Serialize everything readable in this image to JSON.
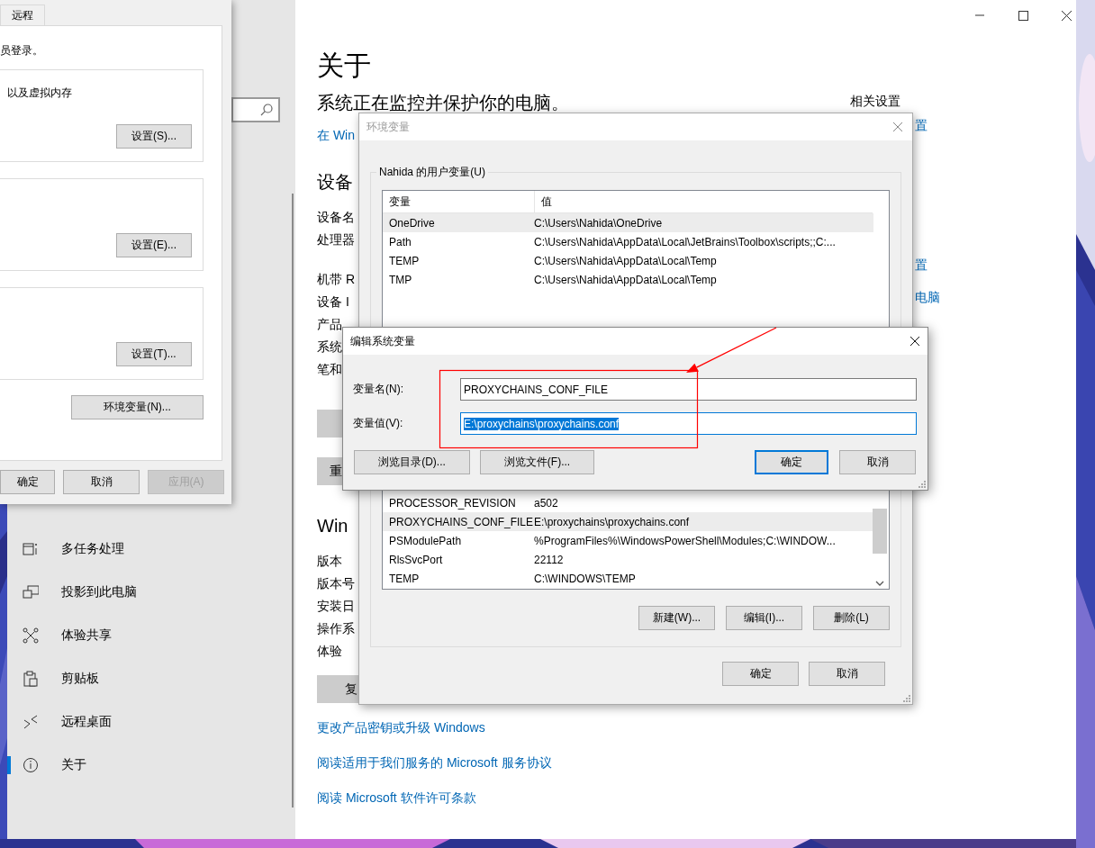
{
  "settings": {
    "nav": [
      {
        "label": "多任务处理",
        "selected": false
      },
      {
        "label": "投影到此电脑",
        "selected": false
      },
      {
        "label": "体验共享",
        "selected": false
      },
      {
        "label": "剪贴板",
        "selected": false
      },
      {
        "label": "远程桌面",
        "selected": false
      },
      {
        "label": "关于",
        "selected": true
      }
    ],
    "page_title": "关于",
    "status": "系统正在监控并保护你的电脑。",
    "status_link": "在 Win",
    "device_heading": "设备",
    "device_labels": [
      [
        "设备名",
        "处理器"
      ],
      [
        "机带 R",
        "设备 I",
        "产品",
        "系统",
        "笔和"
      ]
    ],
    "device_buttons": [
      {
        "kind": "button"
      },
      {
        "kind": "button",
        "label": "重"
      }
    ],
    "windows_heading": "Win",
    "windows_labels": [
      "版本",
      "版本号",
      "安装日",
      "操作系",
      "体验"
    ],
    "windows_button": "复",
    "links": [
      "更改产品密钥或升级 Windows",
      "阅读适用于我们服务的 Microsoft 服务协议",
      "阅读 Microsoft 软件许可条款"
    ],
    "related": {
      "title": "相关设置",
      "links": [
        "置",
        "置",
        "电脑"
      ]
    }
  },
  "system_properties": {
    "tab": {
      "label": "远程",
      "selected": false
    },
    "text": "员登录。",
    "groups": [
      {
        "text": "以及虚拟内存",
        "button": "设置(S)..."
      },
      {
        "button": "设置(E)..."
      },
      {
        "button": "设置(T)..."
      }
    ],
    "env_button": "环境变量(N)...",
    "buttons": [
      {
        "label": "确定",
        "disabled": false
      },
      {
        "label": "取消",
        "disabled": false
      },
      {
        "label": "应用(A)",
        "disabled": true
      }
    ]
  },
  "env_window": {
    "title": "环境变量",
    "active": false,
    "user_group": "Nahida 的用户变量(U)",
    "columns": [
      "变量",
      "值"
    ],
    "user_rows": [
      {
        "name": "OneDrive",
        "value": "C:\\Users\\Nahida\\OneDrive",
        "selected": true
      },
      {
        "name": "Path",
        "value": "C:\\Users\\Nahida\\AppData\\Local\\JetBrains\\Toolbox\\scripts;;C:...",
        "selected": false
      },
      {
        "name": "TEMP",
        "value": "C:\\Users\\Nahida\\AppData\\Local\\Temp",
        "selected": false
      },
      {
        "name": "TMP",
        "value": "C:\\Users\\Nahida\\AppData\\Local\\Temp",
        "selected": false
      }
    ],
    "system_rows": [
      {
        "name": "PROCESSOR_REVISION",
        "value": "a502",
        "selected": false
      },
      {
        "name": "PROXYCHAINS_CONF_FILE",
        "value": "E:\\proxychains\\proxychains.conf",
        "selected": true
      },
      {
        "name": "PSModulePath",
        "value": "%ProgramFiles%\\WindowsPowerShell\\Modules;C:\\WINDOW...",
        "selected": false
      },
      {
        "name": "RlsSvcPort",
        "value": "22112",
        "selected": false
      },
      {
        "name": "TEMP",
        "value": "C:\\WINDOWS\\TEMP",
        "selected": false
      }
    ],
    "system_buttons": [
      "新建(W)...",
      "编辑(I)...",
      "删除(L)"
    ],
    "buttons": [
      "确定",
      "取消"
    ]
  },
  "edit_dialog": {
    "title": "编辑系统变量",
    "active": true,
    "fields": [
      {
        "label": "变量名(N):",
        "value": "PROXYCHAINS_CONF_FILE",
        "focused": false
      },
      {
        "label": "变量值(V):",
        "value": "E:\\proxychains\\proxychains.conf",
        "focused": true
      }
    ],
    "buttons": [
      {
        "label": "浏览目录(D)...",
        "default": false
      },
      {
        "label": "浏览文件(F)...",
        "default": false
      },
      {
        "label": "确定",
        "default": true
      },
      {
        "label": "取消",
        "default": false
      }
    ]
  },
  "annotations": [
    {
      "kind": "frame"
    },
    {
      "kind": "arrow"
    }
  ]
}
